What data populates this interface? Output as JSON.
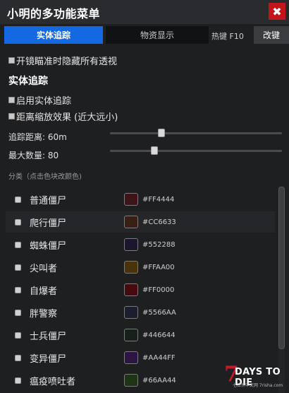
{
  "window": {
    "title": "小明的多功能菜单",
    "close_label": "✖"
  },
  "tabs": {
    "entity_tracking": "实体追踪",
    "material_display": "物资显示",
    "hotkey_text": "热键 F10",
    "change_key_label": "改键"
  },
  "options": {
    "hide_all_esp_on_scope": "开镜瞄准时隐藏所有透视",
    "section_title": "实体追踪",
    "enable_entity_tracking": "启用实体追踪",
    "distance_scaling": "距离缩放效果 (近大远小)"
  },
  "sliders": {
    "tracking_distance_label": "追踪距离: 60m",
    "tracking_distance_value_m": 60,
    "max_count_label": "最大数量: 80",
    "max_count_value": 80
  },
  "categories": {
    "caption": "分类（点击色块改颜色)",
    "items": [
      {
        "name": "普通僵尸",
        "hex": "#FF4444"
      },
      {
        "name": "爬行僵尸",
        "hex": "#CC6633"
      },
      {
        "name": "蜘蛛僵尸",
        "hex": "#552288"
      },
      {
        "name": "尖叫者",
        "hex": "#FFAA00"
      },
      {
        "name": "自爆者",
        "hex": "#FF0000"
      },
      {
        "name": "胖警察",
        "hex": "#5566AA"
      },
      {
        "name": "士兵僵尸",
        "hex": "#446644"
      },
      {
        "name": "变异僵尸",
        "hex": "#AA44FF"
      },
      {
        "name": "瘟疫喷吐者",
        "hex": "#66AA44"
      }
    ]
  },
  "colors": {
    "accent": "#1469E2",
    "close": "#C2151B",
    "background": "#1E1F21"
  },
  "watermark": {
    "seven": "7",
    "title": "DAYS TO DIE",
    "subtitle": "七日杀中文网 7risha.com"
  }
}
